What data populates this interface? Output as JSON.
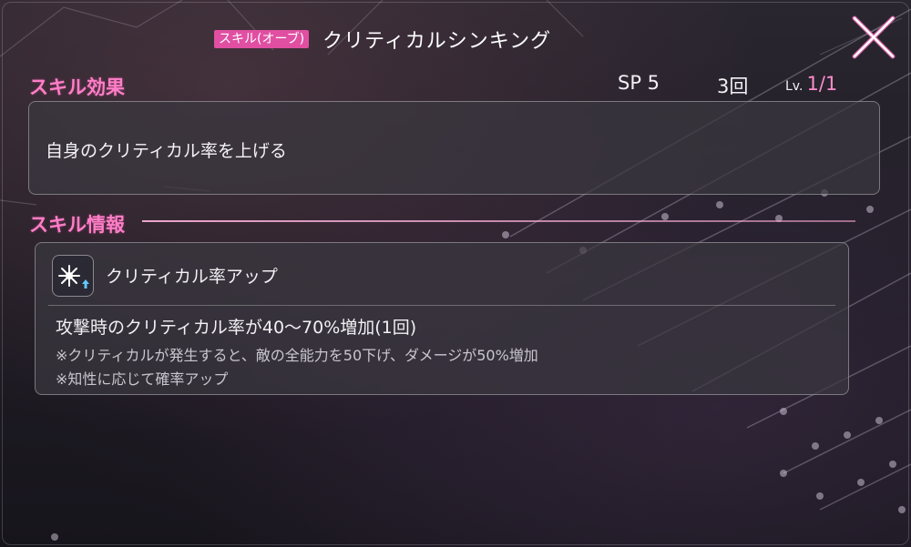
{
  "header": {
    "tag": "スキル(オーブ)",
    "skill_name": "クリティカルシンキング"
  },
  "effect": {
    "section_title": "スキル効果",
    "sp": "SP 5",
    "uses": "3回",
    "level_label": "Lv.",
    "level_value": "1/1",
    "text": "自身のクリティカル率を上げる"
  },
  "info": {
    "section_title": "スキル情報",
    "icon": "critical-spark-up-icon",
    "name": "クリティカル率アップ",
    "line1": "攻撃時のクリティカル率が40〜70%増加(1回)",
    "note1": "※クリティカルが発生すると、敵の全能力を50下げ、ダメージが50%増加",
    "note2": "※知性に応じて確率アップ"
  },
  "colors": {
    "accent_pink": "#ff7ec8",
    "tag_pink": "#e04fa2",
    "panel_bg": "#3a3840",
    "text": "#f2f0f4"
  }
}
